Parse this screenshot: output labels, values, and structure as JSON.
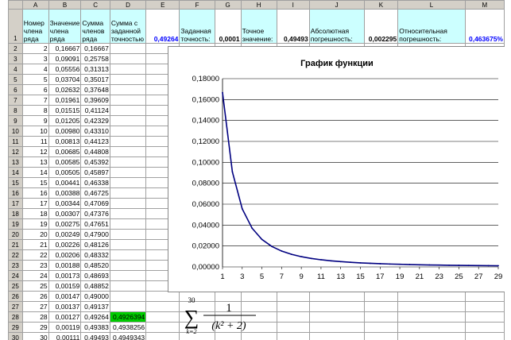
{
  "columns": [
    "A",
    "B",
    "C",
    "D",
    "E",
    "F",
    "G",
    "H",
    "I",
    "J",
    "K",
    "L",
    "M"
  ],
  "header_row": {
    "row_num": "1",
    "A": "Номер члена ряда",
    "B": "Значение члена ряда",
    "C": "Сумма членов ряда",
    "D": "Сумма с заданной точностью",
    "E": "0,49264",
    "F": "Заданная точность:",
    "G": "0,0001",
    "H": "Точное значение:",
    "I": "0,49493",
    "J": "Абсолютная погрешность:",
    "K": "0,002295",
    "L": "Относительная погрешность:",
    "M": "0,463675%"
  },
  "rows": [
    {
      "r": "2",
      "a": "2",
      "b": "0,16667",
      "c": "0,16667",
      "d": ""
    },
    {
      "r": "3",
      "a": "3",
      "b": "0,09091",
      "c": "0,25758",
      "d": ""
    },
    {
      "r": "4",
      "a": "4",
      "b": "0,05556",
      "c": "0,31313",
      "d": ""
    },
    {
      "r": "5",
      "a": "5",
      "b": "0,03704",
      "c": "0,35017",
      "d": ""
    },
    {
      "r": "6",
      "a": "6",
      "b": "0,02632",
      "c": "0,37648",
      "d": ""
    },
    {
      "r": "7",
      "a": "7",
      "b": "0,01961",
      "c": "0,39609",
      "d": ""
    },
    {
      "r": "8",
      "a": "8",
      "b": "0,01515",
      "c": "0,41124",
      "d": ""
    },
    {
      "r": "9",
      "a": "9",
      "b": "0,01205",
      "c": "0,42329",
      "d": ""
    },
    {
      "r": "10",
      "a": "10",
      "b": "0,00980",
      "c": "0,43310",
      "d": ""
    },
    {
      "r": "11",
      "a": "11",
      "b": "0,00813",
      "c": "0,44123",
      "d": ""
    },
    {
      "r": "12",
      "a": "12",
      "b": "0,00685",
      "c": "0,44808",
      "d": ""
    },
    {
      "r": "13",
      "a": "13",
      "b": "0,00585",
      "c": "0,45392",
      "d": ""
    },
    {
      "r": "14",
      "a": "14",
      "b": "0,00505",
      "c": "0,45897",
      "d": ""
    },
    {
      "r": "15",
      "a": "15",
      "b": "0,00441",
      "c": "0,46338",
      "d": ""
    },
    {
      "r": "16",
      "a": "16",
      "b": "0,00388",
      "c": "0,46725",
      "d": ""
    },
    {
      "r": "17",
      "a": "17",
      "b": "0,00344",
      "c": "0,47069",
      "d": ""
    },
    {
      "r": "18",
      "a": "18",
      "b": "0,00307",
      "c": "0,47376",
      "d": ""
    },
    {
      "r": "19",
      "a": "19",
      "b": "0,00275",
      "c": "0,47651",
      "d": ""
    },
    {
      "r": "20",
      "a": "20",
      "b": "0,00249",
      "c": "0,47900",
      "d": ""
    },
    {
      "r": "21",
      "a": "21",
      "b": "0,00226",
      "c": "0,48126",
      "d": ""
    },
    {
      "r": "22",
      "a": "22",
      "b": "0,00206",
      "c": "0,48332",
      "d": ""
    },
    {
      "r": "23",
      "a": "23",
      "b": "0,00188",
      "c": "0,48520",
      "d": ""
    },
    {
      "r": "24",
      "a": "24",
      "b": "0,00173",
      "c": "0,48693",
      "d": ""
    },
    {
      "r": "25",
      "a": "25",
      "b": "0,00159",
      "c": "0,48852",
      "d": ""
    },
    {
      "r": "26",
      "a": "26",
      "b": "0,00147",
      "c": "0,49000",
      "d": ""
    },
    {
      "r": "27",
      "a": "27",
      "b": "0,00137",
      "c": "0,49137",
      "d": ""
    },
    {
      "r": "28",
      "a": "28",
      "b": "0,00127",
      "c": "0,49264",
      "d": "0,4926394"
    },
    {
      "r": "29",
      "a": "29",
      "b": "0,00119",
      "c": "0,49383",
      "d": "0,4938256"
    },
    {
      "r": "30",
      "a": "30",
      "b": "0,00111",
      "c": "0,49493",
      "d": "0,4949343"
    }
  ],
  "highlight_row": "28",
  "colors": {
    "header_fill": "#ccffff",
    "highlight_fill": "#00cc00",
    "value_text": "#0000ff",
    "line": "#000080"
  },
  "formula": {
    "upper": "30",
    "lower": "k=2",
    "numerator": "1",
    "denominator": "(k² + 2)"
  },
  "chart_data": {
    "type": "line",
    "title": "График функции",
    "x": [
      1,
      2,
      3,
      4,
      5,
      6,
      7,
      8,
      9,
      10,
      11,
      12,
      13,
      14,
      15,
      16,
      17,
      18,
      19,
      20,
      21,
      22,
      23,
      24,
      25,
      26,
      27,
      28,
      29
    ],
    "series": [
      {
        "values": [
          0.16667,
          0.09091,
          0.05556,
          0.03704,
          0.02632,
          0.01961,
          0.01515,
          0.01205,
          0.0098,
          0.00813,
          0.00685,
          0.00585,
          0.00505,
          0.00441,
          0.00388,
          0.00344,
          0.00307,
          0.00275,
          0.00249,
          0.00226,
          0.00206,
          0.00188,
          0.00173,
          0.00159,
          0.00147,
          0.00137,
          0.00127,
          0.00119,
          0.00111
        ]
      }
    ],
    "x_tick_labels": [
      "1",
      "3",
      "5",
      "7",
      "9",
      "11",
      "13",
      "15",
      "17",
      "19",
      "21",
      "23",
      "25",
      "27",
      "29"
    ],
    "y_tick_labels": [
      "0,00000",
      "0,02000",
      "0,04000",
      "0,06000",
      "0,08000",
      "0,10000",
      "0,12000",
      "0,14000",
      "0,16000",
      "0,18000"
    ],
    "ylim": [
      0,
      0.18
    ],
    "xlim": [
      1,
      29
    ],
    "grid": true,
    "legend": "none"
  }
}
